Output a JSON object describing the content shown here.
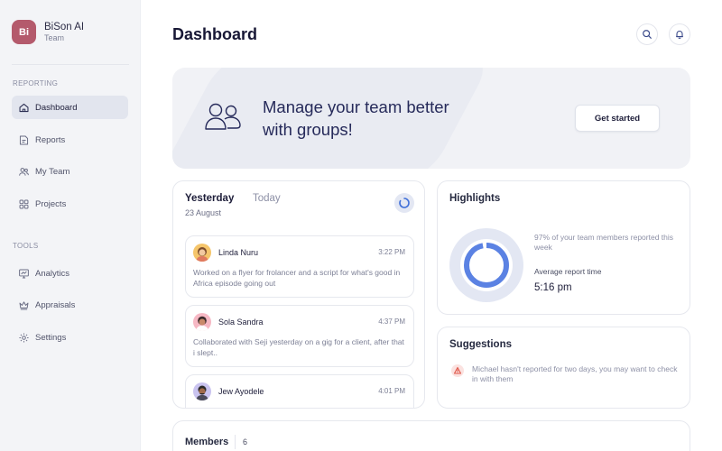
{
  "brand": {
    "initials": "Bi",
    "name": "BiSon AI",
    "subtitle": "Team",
    "color": "#b45a6c"
  },
  "sidebar": {
    "sections": [
      {
        "label": "REPORTING"
      },
      {
        "label": "TOOLS"
      }
    ],
    "items": [
      {
        "label": "Dashboard",
        "icon": "home-icon",
        "active": true
      },
      {
        "label": "Reports",
        "icon": "document-icon"
      },
      {
        "label": "My Team",
        "icon": "users-icon"
      },
      {
        "label": "Projects",
        "icon": "grid-icon"
      },
      {
        "label": "Analytics",
        "icon": "chart-icon"
      },
      {
        "label": "Appraisals",
        "icon": "crown-icon"
      },
      {
        "label": "Settings",
        "icon": "gear-icon"
      }
    ]
  },
  "header": {
    "title": "Dashboard",
    "actions": [
      "search-icon",
      "bell-icon"
    ]
  },
  "banner": {
    "line1": "Manage your team better",
    "line2": "with groups!",
    "cta": "Get started"
  },
  "activity": {
    "tabs": [
      {
        "label": "Yesterday",
        "active": true
      },
      {
        "label": "Today",
        "active": false
      }
    ],
    "date": "23 August",
    "items": [
      {
        "name": "Linda Nuru",
        "time": "3:22 PM",
        "text": "Worked on a flyer for frolancer and a script for what's good in Africa episode going out"
      },
      {
        "name": "Sola Sandra",
        "time": "4:37 PM",
        "text": "Collaborated with Seji yesterday on a gig for a client, after that i slept.."
      },
      {
        "name": "Jew Ayodele",
        "time": "4:01 PM",
        "text": ""
      }
    ]
  },
  "highlights": {
    "title": "Highlights",
    "percent_reported": 97,
    "summary": "97% of your team members reported this week",
    "avg_label": "Average report time",
    "avg_value": "5:16 pm",
    "accent": "#5b82e3"
  },
  "suggestions": {
    "title": "Suggestions",
    "items": [
      {
        "icon": "warning-icon",
        "text": "Michael hasn't reported for two days, you may want to check in with them"
      }
    ]
  },
  "members": {
    "title": "Members",
    "count": "6"
  }
}
